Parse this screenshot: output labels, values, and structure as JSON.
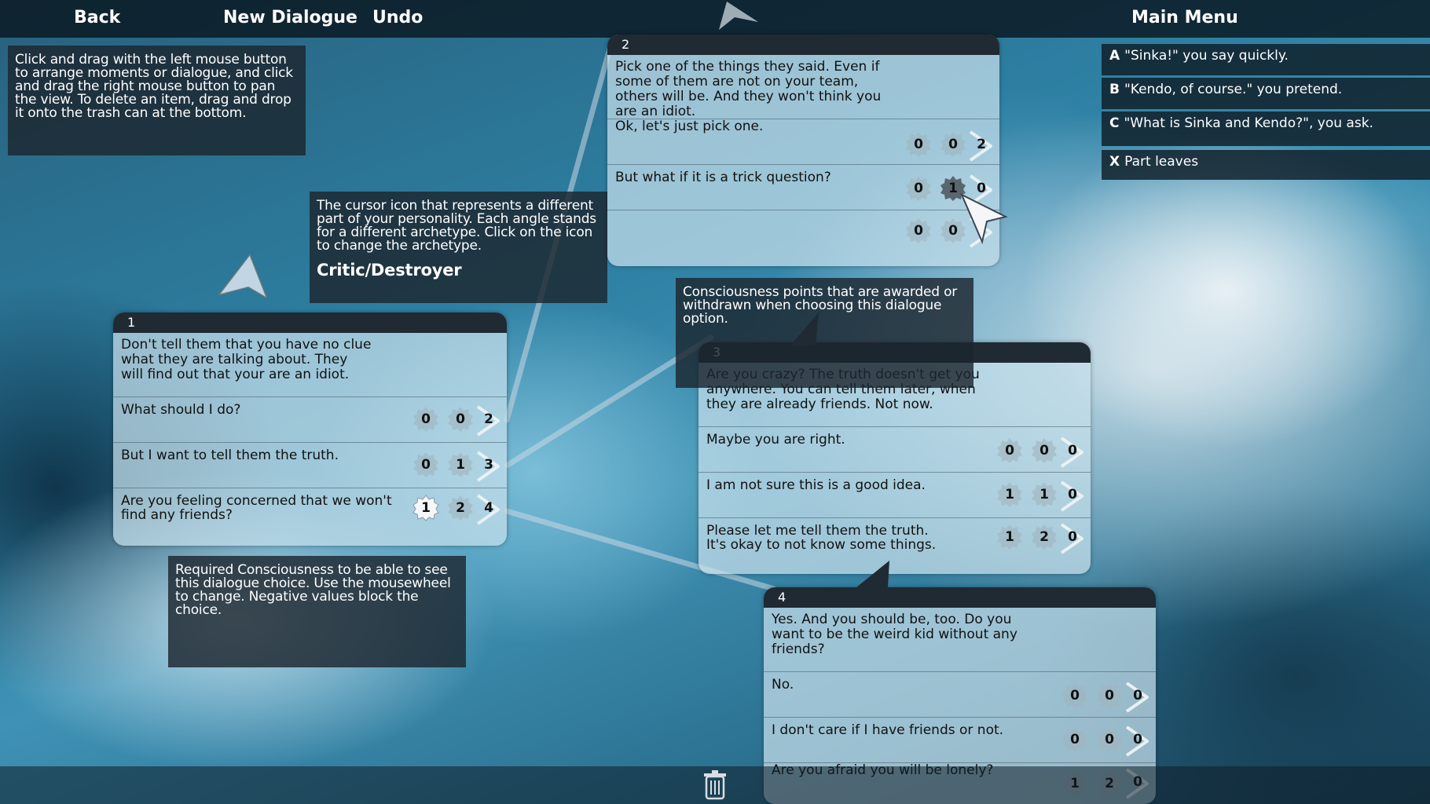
{
  "topbar": {
    "back": "Back",
    "new_dialogue": "New Dialogue",
    "undo": "Undo",
    "main_menu": "Main Menu"
  },
  "tips": {
    "instructions": "Click and drag with the left mouse button to arrange moments or dialogue, and click and drag the right mouse button to pan the view. To delete an item, drag and drop it onto the trash can at the bottom.",
    "cursor_icon": "The cursor icon that represents a different part of your personality. Each angle stands for a different archetype. Click on the icon to change the archetype.",
    "archetype": "Critic/Destroyer",
    "consciousness_points": "Consciousness points that are awarded or withdrawn when choosing this dialogue option.",
    "required_consciousness": "Required Consciousness to be able to see this dialogue choice. Use the mousewheel to change. Negative values block the choice."
  },
  "nodes": {
    "n1": {
      "id": "1",
      "prompt": "Don't tell them that you have no clue what they are talking about. They will find out that your are an idiot.",
      "rows": [
        {
          "text": "What should I do?",
          "a": "0",
          "b": "0",
          "c": "2"
        },
        {
          "text": "But I want to tell them the truth.",
          "a": "0",
          "b": "1",
          "c": "3"
        },
        {
          "text": "Are you feeling concerned that we won't find any friends?",
          "a": "1",
          "b": "2",
          "c": "4"
        }
      ]
    },
    "n2": {
      "id": "2",
      "prompt": "Pick one of the things they said. Even if some of them are not on your team, others  will be. And they won't think you are an idiot.",
      "rows": [
        {
          "text": "Ok, let's just pick one.",
          "a": "0",
          "b": "0",
          "c": "2"
        },
        {
          "text": "But what if it is a trick question?",
          "a": "0",
          "b": "1",
          "c": "0"
        },
        {
          "text": "",
          "a": "0",
          "b": "0",
          "c": ""
        }
      ]
    },
    "n3": {
      "id": "3",
      "prompt": "Are you crazy? The truth doesn't get you anywhere. You can tell them later, when they are already friends. Not now.",
      "rows": [
        {
          "text": "Maybe you are right.",
          "a": "0",
          "b": "0",
          "c": "0"
        },
        {
          "text": "I am not sure this is a good idea.",
          "a": "1",
          "b": "1",
          "c": "0"
        },
        {
          "text": "Please let me tell them the truth.\nIt's okay to not know some things.",
          "a": "1",
          "b": "2",
          "c": "0"
        }
      ]
    },
    "n4": {
      "id": "4",
      "prompt": "Yes. And you should be, too. Do you want to be the weird kid without any friends?",
      "rows": [
        {
          "text": "No.",
          "a": "0",
          "b": "0",
          "c": "0"
        },
        {
          "text": "I don't care if I have friends or not.",
          "a": "0",
          "b": "0",
          "c": "0"
        },
        {
          "text": "Are you afraid you will be lonely?",
          "a": "1",
          "b": "2",
          "c": "0"
        }
      ]
    }
  },
  "menu_options": [
    {
      "key": "A",
      "text": "\"Sinka!\" you say quickly."
    },
    {
      "key": "B",
      "text": "\"Kendo, of course.\" you pretend."
    },
    {
      "key": "C",
      "text": "\"What is Sinka and Kendo?\", you ask."
    },
    {
      "key": "X",
      "text": "Part leaves"
    }
  ],
  "icons": {
    "trash": "trash-can-icon",
    "cursor": "archetype-cursor-icon",
    "gear": "consciousness-gear-icon",
    "arrow": "link-arrow-icon"
  },
  "colors": {
    "topbar": "#0a1620",
    "node_header": "#1f2a33",
    "node_body": "#c8e1eb"
  }
}
